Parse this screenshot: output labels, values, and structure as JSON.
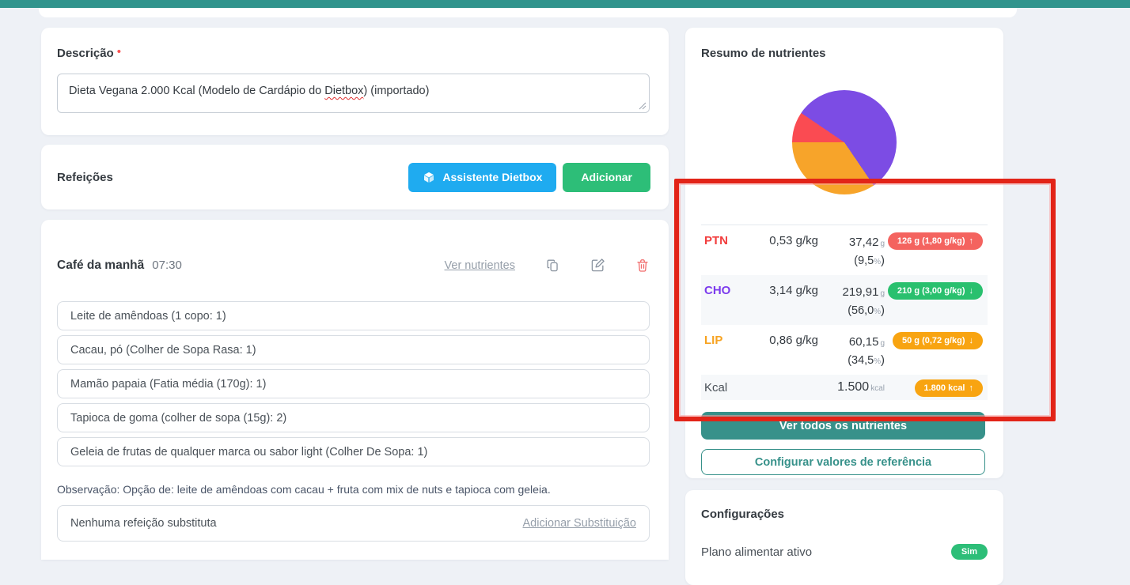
{
  "description_card": {
    "title": "Descrição",
    "required_marker": "•",
    "value": "Dieta Vegana 2.000 Kcal (Modelo de Cardápio do Dietbox) (importado)",
    "value_parts": {
      "before": "Dieta Vegana 2.000 Kcal (Modelo de Cardápio do ",
      "misspelled": "Dietbox",
      "after": ") (importado)"
    }
  },
  "meals_card": {
    "title": "Refeições",
    "assistant_button": "Assistente Dietbox",
    "add_button": "Adicionar",
    "assistant_color": "#1fabf0",
    "add_color": "#2dbe78"
  },
  "meal_card": {
    "name": "Café da manhã",
    "time": "07:30",
    "view_nutrients_link": "Ver nutrientes",
    "items": [
      "Leite de amêndoas (1 copo: 1)",
      "Cacau, pó (Colher de Sopa Rasa: 1)",
      "Mamão papaia (Fatia média (170g): 1)",
      "Tapioca de goma (colher de sopa (15g): 2)",
      "Geleia de frutas de qualquer marca ou sabor light (Colher De Sopa: 1)"
    ],
    "observation": "Observação: Opção de: leite de amêndoas com cacau + fruta com mix de nuts e tapioca com geleia.",
    "substitute_text": "Nenhuma refeição substituta",
    "add_substitution_link": "Adicionar Substituição"
  },
  "nutrients_card": {
    "title": "Resumo de nutrientes",
    "chart_data": {
      "type": "pie",
      "title": "Resumo de nutrientes",
      "start_angle_deg": 270,
      "slices": [
        {
          "label": "PTN",
          "percent": 9.5,
          "color": "#fa4b52"
        },
        {
          "label": "CHO",
          "percent": 56.0,
          "color": "#7c4ce4"
        },
        {
          "label": "LIP",
          "percent": 34.5,
          "color": "#f7a42a"
        }
      ]
    },
    "rows": [
      {
        "label": "PTN",
        "label_color": "#f23e3e",
        "per_kg": "0,53 g/kg",
        "amount": "37,42",
        "unit": "g",
        "pct_open": "(9,5",
        "pct_sign": "%",
        "pct_close": ")",
        "badge_text": "126 g (1,80 g/kg)",
        "badge_arrow": "↑",
        "badge_color": "#f4635f"
      },
      {
        "label": "CHO",
        "label_color": "#7c3bed",
        "per_kg": "3,14 g/kg",
        "amount": "219,91",
        "unit": "g",
        "pct_open": "(56,0",
        "pct_sign": "%",
        "pct_close": ")",
        "badge_text": "210 g (3,00 g/kg)",
        "badge_arrow": "↓",
        "badge_color": "#29c06e"
      },
      {
        "label": "LIP",
        "label_color": "#f7a321",
        "per_kg": "0,86 g/kg",
        "amount": "60,15",
        "unit": "g",
        "pct_open": "(34,5",
        "pct_sign": "%",
        "pct_close": ")",
        "badge_text": "50 g (0,72 g/kg)",
        "badge_arrow": "↓",
        "badge_color": "#f8a411"
      }
    ],
    "kcal_row": {
      "label": "Kcal",
      "value": "1.500",
      "unit": "kcal",
      "badge_text": "1.800 kcal",
      "badge_arrow": "↑",
      "badge_color": "#f8a411"
    },
    "view_all_button": "Ver todos os nutrientes",
    "configure_button": "Configurar valores de referência"
  },
  "settings_card": {
    "title": "Configurações",
    "row_label": "Plano alimentar ativo",
    "badge": "Sim",
    "badge_color": "#2dbe78"
  },
  "theme": {
    "topbar_color": "#31948d",
    "teal": "#37918a",
    "background": "#eef1f6",
    "annotation_red": "#e22418"
  }
}
